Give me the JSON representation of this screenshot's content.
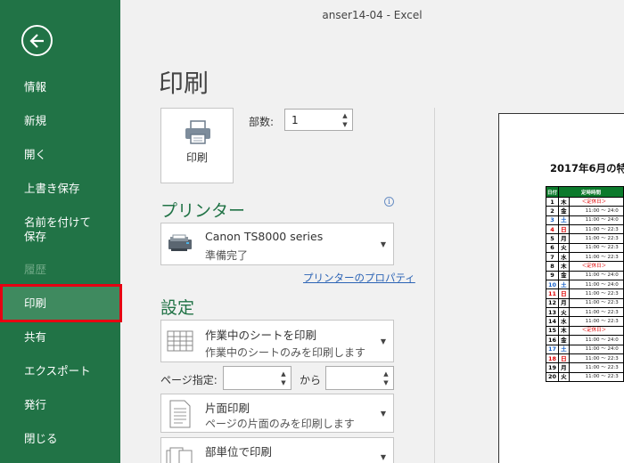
{
  "window": {
    "title": "anser14-04  -  Excel"
  },
  "sidebar": {
    "items": [
      {
        "label": "情報"
      },
      {
        "label": "新規"
      },
      {
        "label": "開く"
      },
      {
        "label": "上書き保存"
      },
      {
        "label": "名前を付けて\n保存"
      },
      {
        "label": "履歴"
      },
      {
        "label": "印刷"
      },
      {
        "label": "共有"
      },
      {
        "label": "エクスポート"
      },
      {
        "label": "発行"
      },
      {
        "label": "閉じる"
      }
    ]
  },
  "page_title": "印刷",
  "print_button": {
    "label": "印刷"
  },
  "copies": {
    "label": "部数:",
    "value": "1"
  },
  "printer": {
    "heading": "プリンター",
    "name": "Canon TS8000 series",
    "status": "準備完了",
    "properties_link": "プリンターのプロパティ"
  },
  "settings": {
    "heading": "設定",
    "print_what": {
      "title": "作業中のシートを印刷",
      "sub": "作業中のシートのみを印刷します"
    },
    "pages_label": "ページ指定:",
    "to_label": "から",
    "sides": {
      "title": "片面印刷",
      "sub": "ページの片面のみを印刷します"
    },
    "collate": {
      "title": "部単位で印刷"
    }
  },
  "preview": {
    "title": "2017年6月の特",
    "headers": [
      "日付",
      "定時時間"
    ],
    "rows": [
      {
        "date": "1",
        "day": "木",
        "time": "＜定休日＞"
      },
      {
        "date": "2",
        "day": "金",
        "time": "11:00 ～ 24:0"
      },
      {
        "date": "3",
        "day": "土",
        "time": "11:00 ～ 24:0"
      },
      {
        "date": "4",
        "day": "日",
        "time": "11:00 ～ 22:3"
      },
      {
        "date": "5",
        "day": "月",
        "time": "11:00 ～ 22:3"
      },
      {
        "date": "6",
        "day": "火",
        "time": "11:00 ～ 22:3"
      },
      {
        "date": "7",
        "day": "水",
        "time": "11:00 ～ 22:3"
      },
      {
        "date": "8",
        "day": "木",
        "time": "＜定休日＞"
      },
      {
        "date": "9",
        "day": "金",
        "time": "11:00 ～ 24:0"
      },
      {
        "date": "10",
        "day": "土",
        "time": "11:00 ～ 24:0"
      },
      {
        "date": "11",
        "day": "日",
        "time": "11:00 ～ 22:3"
      },
      {
        "date": "12",
        "day": "月",
        "time": "11:00 ～ 22:3"
      },
      {
        "date": "13",
        "day": "火",
        "time": "11:00 ～ 22:3"
      },
      {
        "date": "14",
        "day": "水",
        "time": "11:00 ～ 22:3"
      },
      {
        "date": "15",
        "day": "木",
        "time": "＜定休日＞"
      },
      {
        "date": "16",
        "day": "金",
        "time": "11:00 ～ 24:0"
      },
      {
        "date": "17",
        "day": "土",
        "time": "11:00 ～ 24:0"
      },
      {
        "date": "18",
        "day": "日",
        "time": "11:00 ～ 22:3"
      },
      {
        "date": "19",
        "day": "月",
        "time": "11:00 ～ 22:3"
      },
      {
        "date": "20",
        "day": "火",
        "time": "11:00 ～ 22:3"
      }
    ]
  },
  "colors": {
    "excel_green": "#217346",
    "highlight": "#e60012",
    "link": "#2b63b5"
  }
}
